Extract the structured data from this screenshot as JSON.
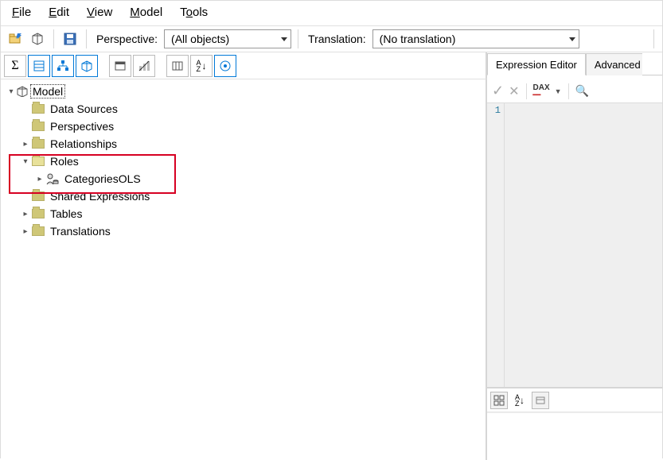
{
  "menu": {
    "file": "File",
    "edit": "Edit",
    "view": "View",
    "model": "Model",
    "tools": "Tools"
  },
  "toolbar": {
    "perspective_label": "Perspective:",
    "perspective_value": "(All objects)",
    "translation_label": "Translation:",
    "translation_value": "(No translation)"
  },
  "tree": {
    "root": "Model",
    "data_sources": "Data Sources",
    "perspectives": "Perspectives",
    "relationships": "Relationships",
    "roles": "Roles",
    "roles_child": "CategoriesOLS",
    "shared_expressions": "Shared Expressions",
    "tables": "Tables",
    "translations": "Translations"
  },
  "right": {
    "tab_expression": "Expression Editor",
    "tab_advanced": "Advanced",
    "dax_label": "DAX",
    "line1": "1"
  },
  "props": {
    "az": "A",
    "z": "Z"
  }
}
